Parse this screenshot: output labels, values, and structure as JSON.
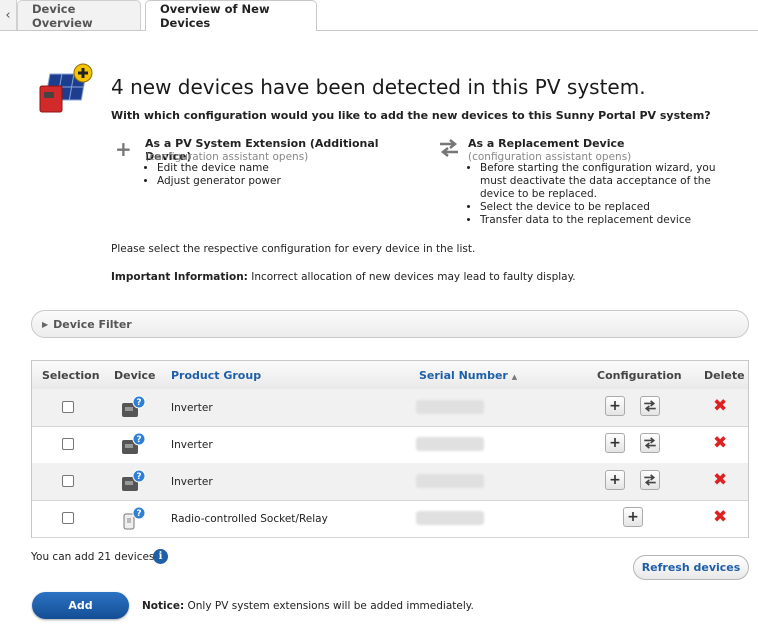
{
  "tabs": {
    "back_icon": "chevron-left-icon",
    "items": [
      "Device Overview",
      "Overview of New Devices"
    ]
  },
  "header": {
    "headline": "4 new devices have been detected in this PV system.",
    "question": "With which configuration would you like to add the new devices to this Sunny Portal PV system?"
  },
  "options": {
    "extension": {
      "icon": "plus-icon",
      "title": "As a PV System Extension (Additional Device)",
      "subtitle": "(configuration assistant opens)",
      "bullets": [
        "Edit the device name",
        "Adjust generator power"
      ]
    },
    "replacement": {
      "icon": "swap-arrows-icon",
      "title": "As a Replacement Device",
      "subtitle": "(configuration assistant opens)",
      "bullets": [
        "Before starting the configuration wizard, you must deactivate the data acceptance of the device to be replaced.",
        "Select the device to be replaced",
        "Transfer data to the replacement device"
      ]
    }
  },
  "instruction": "Please select the respective configuration for every device in the list.",
  "important": {
    "label": "Important Information:",
    "text": "Incorrect allocation of new devices may lead to faulty display."
  },
  "filter": {
    "label": "Device Filter"
  },
  "table": {
    "headers": {
      "selection": "Selection",
      "device": "Device",
      "product_group": "Product Group",
      "serial_number": "Serial Number",
      "sort_indicator": "▲",
      "configuration": "Configuration",
      "delete": "Delete"
    },
    "rows": [
      {
        "product_group": "Inverter",
        "device_icon": "inverter-device-icon",
        "configs": [
          "plus",
          "swap"
        ]
      },
      {
        "product_group": "Inverter",
        "device_icon": "inverter-device-icon",
        "configs": [
          "plus",
          "swap"
        ]
      },
      {
        "product_group": "Inverter",
        "device_icon": "inverter-device-icon",
        "configs": [
          "plus",
          "swap"
        ]
      },
      {
        "product_group": "Radio-controlled Socket/Relay",
        "device_icon": "socket-relay-device-icon",
        "configs": [
          "plus"
        ]
      }
    ]
  },
  "footer": {
    "can_add": "You can add 21 devices.",
    "info_icon": "info-icon",
    "refresh_label": "Refresh devices",
    "add_label": "Add",
    "notice_label": "Notice:",
    "notice_text": "Only PV system extensions will be added immediately."
  },
  "colors": {
    "accent_blue": "#1f5fa8",
    "button_blue": "#134e95",
    "delete_red": "#dd2222"
  }
}
